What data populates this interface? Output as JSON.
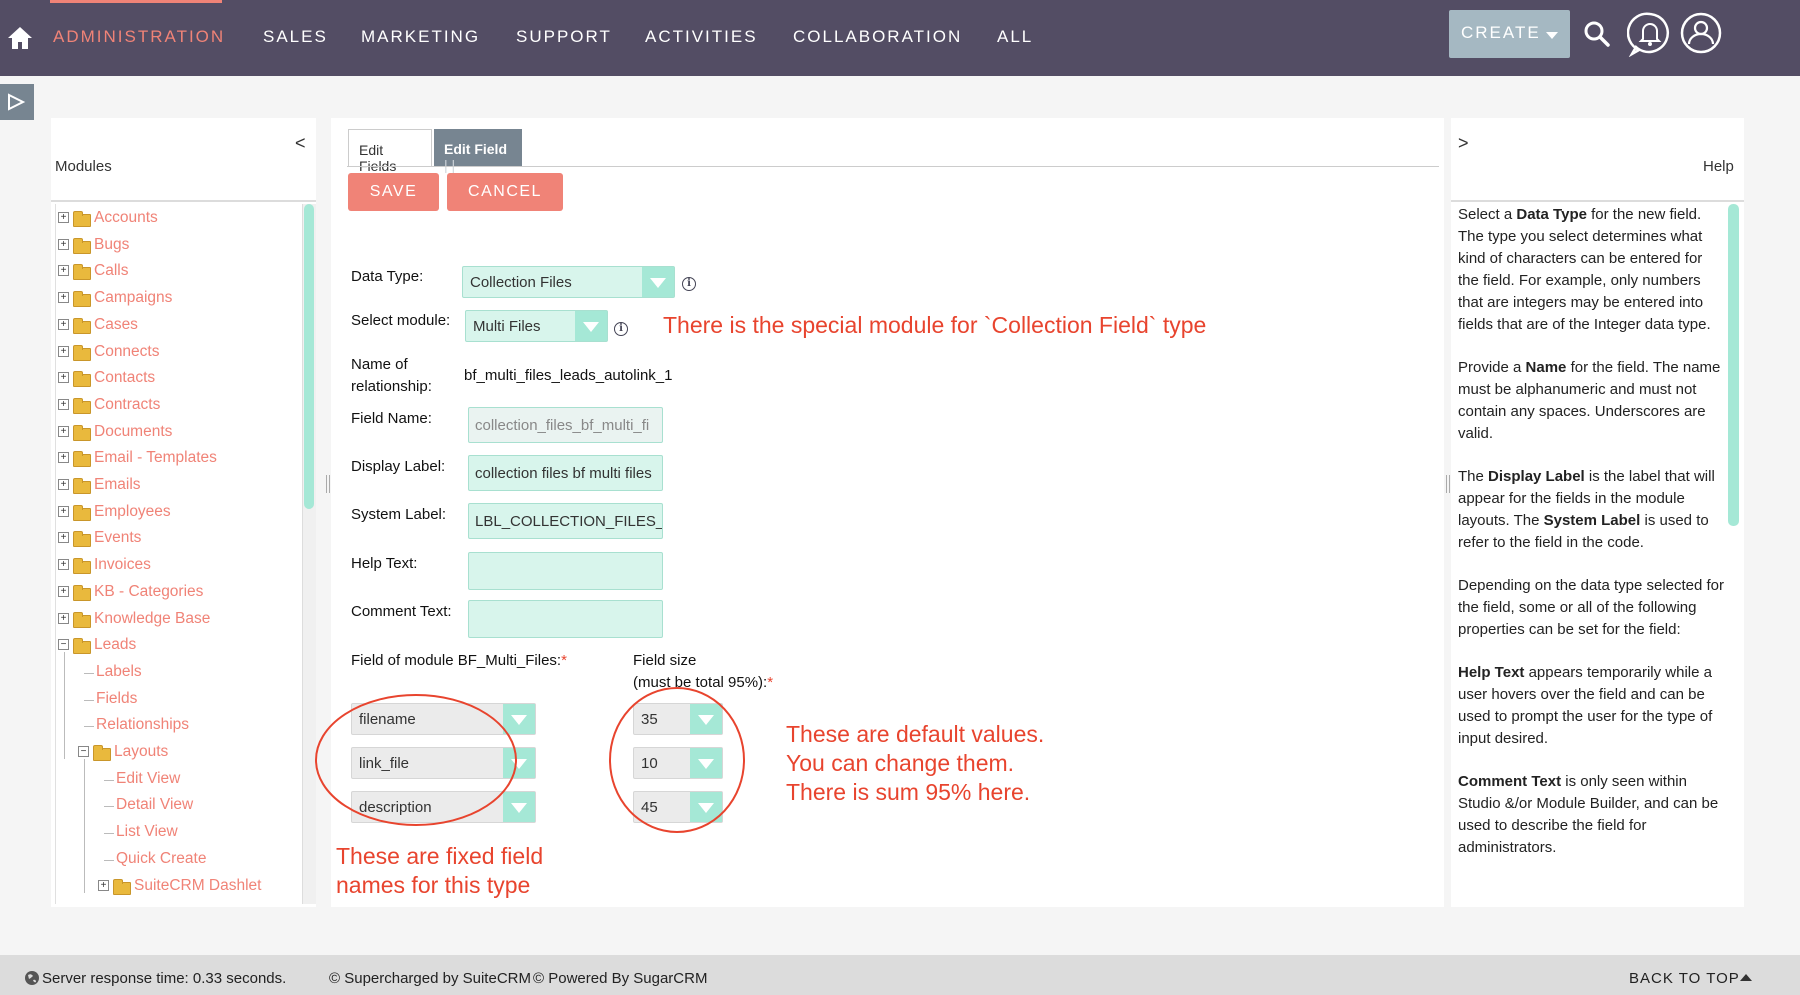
{
  "topnav": {
    "items": [
      "ADMINISTRATION",
      "SALES",
      "MARKETING",
      "SUPPORT",
      "ACTIVITIES",
      "COLLABORATION",
      "ALL"
    ],
    "create_label": "CREATE"
  },
  "left_panel": {
    "title": "Modules",
    "collapse_glyph": "<",
    "tree": [
      "Accounts",
      "Bugs",
      "Calls",
      "Campaigns",
      "Cases",
      "Connects",
      "Contacts",
      "Contracts",
      "Documents",
      "Email - Templates",
      "Emails",
      "Employees",
      "Events",
      "Invoices",
      "KB - Categories",
      "Knowledge Base",
      "Leads",
      "Labels",
      "Fields",
      "Relationships",
      "Layouts",
      "Edit View",
      "Detail View",
      "List View",
      "Quick Create",
      "SuiteCRM Dashlet"
    ]
  },
  "tabs": {
    "edit_fields": "Edit Fields",
    "edit_field": "Edit Field"
  },
  "buttons": {
    "save": "SAVE",
    "cancel": "CANCEL"
  },
  "form": {
    "data_type_label": "Data Type:",
    "data_type_value": "Collection Files",
    "select_module_label": "Select module:",
    "select_module_value": "Multi Files",
    "relationship_label_1": "Name of",
    "relationship_label_2": "relationship:",
    "relationship_value": "bf_multi_files_leads_autolink_1",
    "field_name_label": "Field Name:",
    "field_name_value": "collection_files_bf_multi_fi",
    "display_label_label": "Display Label:",
    "display_label_value": "collection files bf multi files",
    "system_label_label": "System Label:",
    "system_label_value": "LBL_COLLECTION_FILES_",
    "help_text_label": "Help Text:",
    "comment_text_label": "Comment Text:",
    "field_of_module_label": "Field of module BF_Multi_Files:",
    "field_size_label_1": "Field size",
    "field_size_label_2": "(must be total 95%):",
    "required_mark": "*",
    "fields": [
      "filename",
      "link_file",
      "description"
    ],
    "sizes": [
      "35",
      "10",
      "45"
    ]
  },
  "annotations": {
    "special_module": "There is the special module for `Collection Field` type",
    "defaults_1": "These are default values.",
    "defaults_2": "You can change them.",
    "defaults_3": "There is sum 95% here.",
    "fixed_1": "These are fixed field",
    "fixed_2": "names for this type"
  },
  "help": {
    "title": "Help",
    "collapse_glyph": ">",
    "p1_a": "Select a ",
    "p1_b": "Data Type",
    "p1_c": " for the new field. The type you select determines what kind of characters can be entered for the field. For example, only numbers that are integers may be entered into fields that are of the Integer data type.",
    "p2_a": "Provide a ",
    "p2_b": "Name",
    "p2_c": " for the field. The name must be alphanumeric and must not contain any spaces. Underscores are valid.",
    "p3_a": "The ",
    "p3_b": "Display Label",
    "p3_c": " is the label that will appear for the fields in the module layouts. The ",
    "p3_d": "System Label",
    "p3_e": " is used to refer to the field in the code.",
    "p4": "Depending on the data type selected for the field, some or all of the following properties can be set for the field:",
    "p5_b": "Help Text",
    "p5_c": " appears temporarily while a user hovers over the field and can be used to prompt the user for the type of input desired.",
    "p6_b": "Comment Text",
    "p6_c": " is only seen within Studio &/or Module Builder, and can be used to describe the field for administrators."
  },
  "footer": {
    "response": "Server response time: 0.33 seconds.",
    "suite": "© Supercharged by SuiteCRM",
    "sugar": "© Powered By SugarCRM",
    "back_to_top": "BACK TO TOP"
  },
  "colors": {
    "nav_bg": "#534d64",
    "accent": "#f08377",
    "teal": "#a5e8d6",
    "annotation": "#e8442e"
  }
}
